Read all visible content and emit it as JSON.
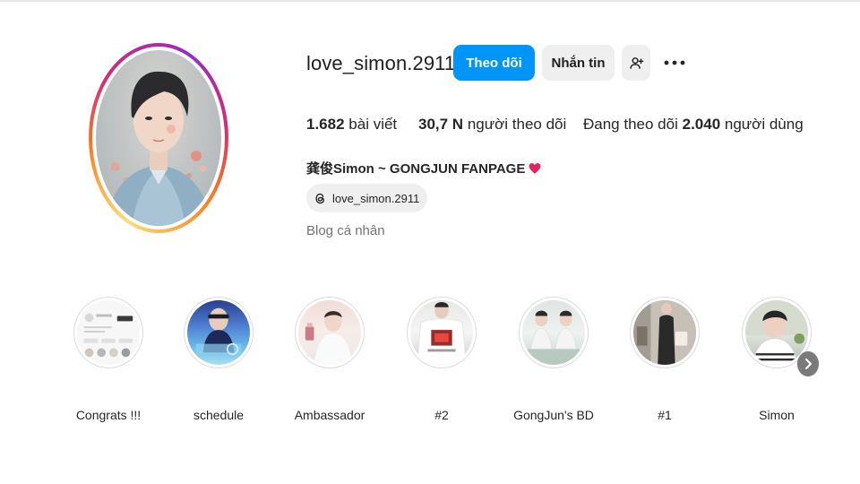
{
  "profile": {
    "username": "love_simon.2911",
    "full_name": "龚俊Simon ~ GONGJUN FANPAGE",
    "threads_handle": "love_simon.2911",
    "category": "Blog cá nhân"
  },
  "actions": {
    "follow_label": "Theo dõi",
    "message_label": "Nhắn tin",
    "add_user_icon": "add-user-icon",
    "more_icon": "more-options-icon"
  },
  "stats": {
    "posts_count": "1.682",
    "posts_label": "bài viết",
    "followers_count": "30,7 N",
    "followers_label": "người theo dõi",
    "following_prefix": "Đang theo dõi",
    "following_count": "2.040",
    "following_label": "người dùng"
  },
  "highlights": [
    {
      "label": "Congrats !!!"
    },
    {
      "label": "schedule"
    },
    {
      "label": "Ambassador"
    },
    {
      "label": "#2"
    },
    {
      "label": "GongJun's BD"
    },
    {
      "label": "#1"
    },
    {
      "label": "Simon"
    }
  ],
  "colors": {
    "primary_button": "#0095f6",
    "secondary_button": "#efefef",
    "heart": "#e0245e",
    "muted_text": "#737373"
  }
}
